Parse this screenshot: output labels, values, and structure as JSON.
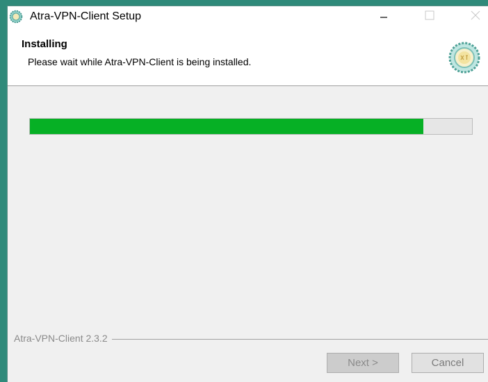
{
  "window": {
    "title": "Atra-VPN-Client Setup",
    "icons": {
      "app": "gear-logo-icon",
      "minimize": "minimize-icon",
      "maximize": "maximize-icon",
      "close": "close-icon"
    }
  },
  "header": {
    "title": "Installing",
    "subtitle": "Please wait while Atra-VPN-Client is being installed.",
    "logo_icon": "atra-logo-icon"
  },
  "progress": {
    "fraction": 0.89,
    "fill_color": "#06b025"
  },
  "footer": {
    "branding": "Atra-VPN-Client 2.3.2",
    "next_label": "Next >",
    "cancel_label": "Cancel"
  }
}
